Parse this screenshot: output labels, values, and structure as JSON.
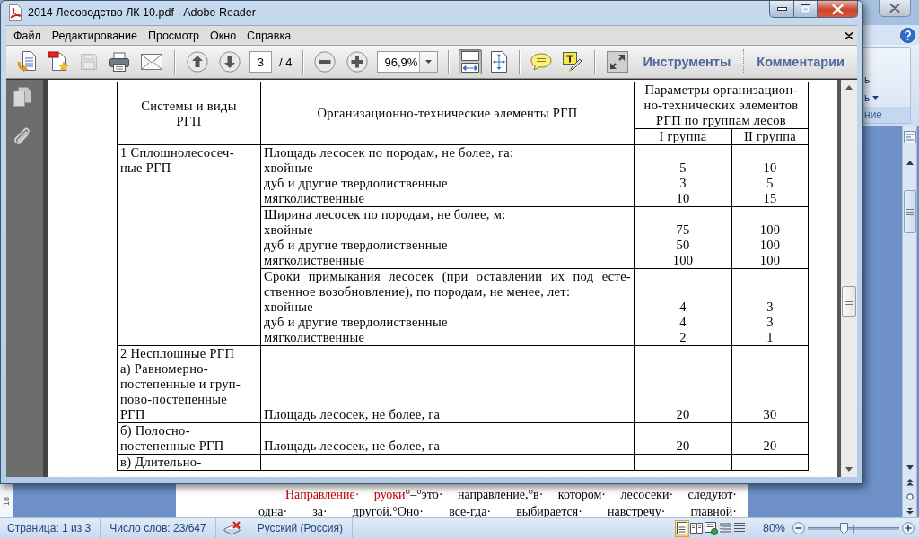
{
  "reader_window": {
    "title": "2014 Лесоводство ЛК 10.pdf - Adobe Reader",
    "menu": [
      "Файл",
      "Редактирование",
      "Просмотр",
      "Окно",
      "Справка"
    ],
    "toolbar": {
      "file_buttons": [
        {
          "disabled": false
        },
        {
          "disabled": false
        },
        {
          "disabled": true
        },
        {
          "disabled": false
        },
        {
          "disabled": false
        }
      ],
      "page_field": {
        "value": "3"
      },
      "page_count": "/ 4",
      "zoom_field": {
        "value": "96,9%"
      },
      "view_buttons": [
        {
          "selected": true
        },
        {
          "selected": false
        }
      ],
      "panels": [
        "Инструменты",
        "Комментарии"
      ]
    },
    "table": {
      "columns": [
        {
          "lines": [
            "Системы и виды",
            "РГП"
          ]
        },
        {
          "lines": [
            "Организационно-технические элементы РГП"
          ]
        },
        {
          "lines": [
            "Параметры организацион-",
            "но-технических элементов",
            "РГП по группам лесов"
          ],
          "subcolumns": [
            "I группа",
            "II группа"
          ]
        }
      ],
      "rows": [
        {
          "system": [
            "1 Сплошнолесосеч-",
            "ные РГП"
          ],
          "elements": [
            {
              "heading": [
                "Площадь лесосек по породам, не более, га:"
              ],
              "items": [
                {
                  "label": "хвойные",
                  "group_1": "5",
                  "group_2": "10"
                },
                {
                  "label": "дуб и другие твердолиственные",
                  "group_1": "3",
                  "group_2": "5"
                },
                {
                  "label": "мягколиственные",
                  "group_1": "10",
                  "group_2": "15"
                }
              ]
            },
            {
              "heading": [
                "Ширина лесосек по породам, не более, м:"
              ],
              "items": [
                {
                  "label": "хвойные",
                  "group_1": "75",
                  "group_2": "100"
                },
                {
                  "label": "дуб и другие твердолиственные",
                  "group_1": "50",
                  "group_2": "100"
                },
                {
                  "label": "мягколиственные",
                  "group_1": "100",
                  "group_2": "100"
                }
              ]
            },
            {
              "heading": [
                "Сроки примыкания лесосек (при оставлении их под есте-",
                "ственное возобновление), по породам, не менее, лет:"
              ],
              "items": [
                {
                  "label": "хвойные",
                  "group_1": "4",
                  "group_2": "3"
                },
                {
                  "label": "дуб и другие твердолиственные",
                  "group_1": "4",
                  "group_2": "3"
                },
                {
                  "label": "мягколиственные",
                  "group_1": "2",
                  "group_2": "1"
                }
              ]
            }
          ]
        },
        {
          "system": [
            "2 Несплошные РГП",
            "а) Равномерно-",
            "постепенные и груп-",
            "пово-постепенные",
            "РГП"
          ],
          "elements": [
            {
              "items": [
                {
                  "label": "Площадь лесосек, не более, га",
                  "group_1": "20",
                  "group_2": "30"
                }
              ]
            }
          ]
        },
        {
          "system": [
            "б) Полосно-",
            "постепенные РГП"
          ],
          "elements": [
            {
              "items": [
                {
                  "label": "Площадь лесосек, не более, га",
                  "group_1": "20",
                  "group_2": "20"
                }
              ]
            }
          ]
        },
        {
          "system": [
            "в) Длительно-"
          ]
        }
      ]
    }
  },
  "word_window": {
    "ribbon_group": {
      "commands": [
        {
          "label": "ь",
          "has_menu": false
        },
        {
          "label": "ь",
          "has_menu": true
        }
      ],
      "label": "ние"
    },
    "ruler_label": "18",
    "document_lines": [
      {
        "segments": [
          {
            "text": "Направление· руоки",
            "kind": "term"
          },
          {
            "text": "°–°это· направление,°в· котором· лесосеки· следуют·",
            "kind": "plain"
          }
        ]
      },
      {
        "segments": [
          {
            "text": "одна· за· другой.°Оно· ",
            "kind": "plain"
          },
          {
            "text": "все-гда",
            "kind": "misspelled"
          },
          {
            "text": "· выбирается· навстречу· главной·",
            "kind": "plain"
          }
        ]
      }
    ],
    "status_bar": {
      "page": "Страница: 1 из 3",
      "word_count": "Число слов: 23/647",
      "language": "Русский (Россия)",
      "view_buttons": [
        {
          "selected": true
        },
        {
          "selected": false
        },
        {
          "selected": false
        },
        {
          "selected": false
        },
        {
          "selected": false
        }
      ],
      "zoom": "80%",
      "zoom_slider": {
        "level": 0.4
      }
    }
  }
}
